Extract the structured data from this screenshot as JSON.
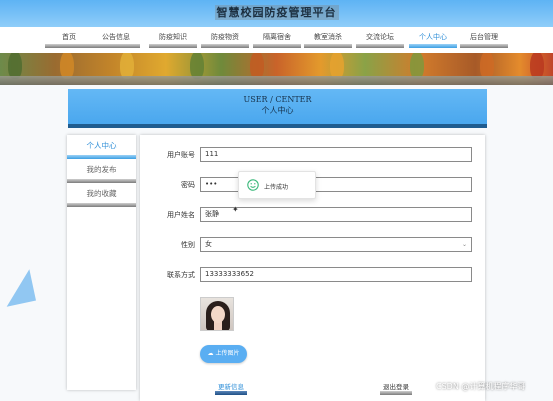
{
  "app": {
    "title": "智慧校园防疫管理平台"
  },
  "nav": {
    "items": [
      {
        "label": "首页"
      },
      {
        "label": "公告信息"
      },
      {
        "label": "防疫知识"
      },
      {
        "label": "防疫物资"
      },
      {
        "label": "隔离宿舍"
      },
      {
        "label": "教室消杀"
      },
      {
        "label": "交流论坛"
      },
      {
        "label": "个人中心",
        "active": true
      },
      {
        "label": "后台管理"
      }
    ]
  },
  "header": {
    "en": "USER / CENTER",
    "cn": "个人中心"
  },
  "sidebar": {
    "items": [
      {
        "label": "个人中心",
        "active": true
      },
      {
        "label": "我的发布"
      },
      {
        "label": "我的收藏"
      }
    ]
  },
  "form": {
    "username": {
      "label": "用户账号",
      "value": "111"
    },
    "password": {
      "label": "密码",
      "value": "•••"
    },
    "name": {
      "label": "用户姓名",
      "value": "张静"
    },
    "gender": {
      "label": "性别",
      "value": "女"
    },
    "phone": {
      "label": "联系方式",
      "value": "13333333652"
    },
    "upload_button": "上传图片",
    "update_button": "更新信息",
    "logout_button": "退出登录"
  },
  "toast": {
    "message": "上传成功"
  },
  "watermark": "CSDN @计算机程序华哥",
  "colors": {
    "accent": "#5aaef2",
    "header_bar": "#4aa7ee"
  }
}
